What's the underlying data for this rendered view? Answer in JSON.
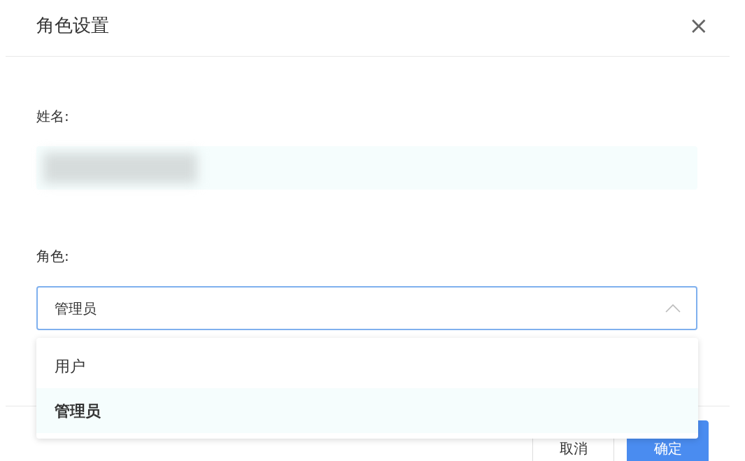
{
  "dialog": {
    "title": "角色设置",
    "close": "×"
  },
  "fields": [
    {
      "label": "姓名:",
      "kind": "redacted"
    },
    {
      "label": "角色:",
      "kind": "select",
      "value": "管理员",
      "expanded": true
    }
  ],
  "dropdown": {
    "options": [
      {
        "label": "用户",
        "selected": false
      },
      {
        "label": "管理员",
        "selected": true
      }
    ]
  },
  "buttons": [
    {
      "label": "取消",
      "kind": "secondary"
    },
    {
      "label": "确定",
      "kind": "primary"
    }
  ]
}
